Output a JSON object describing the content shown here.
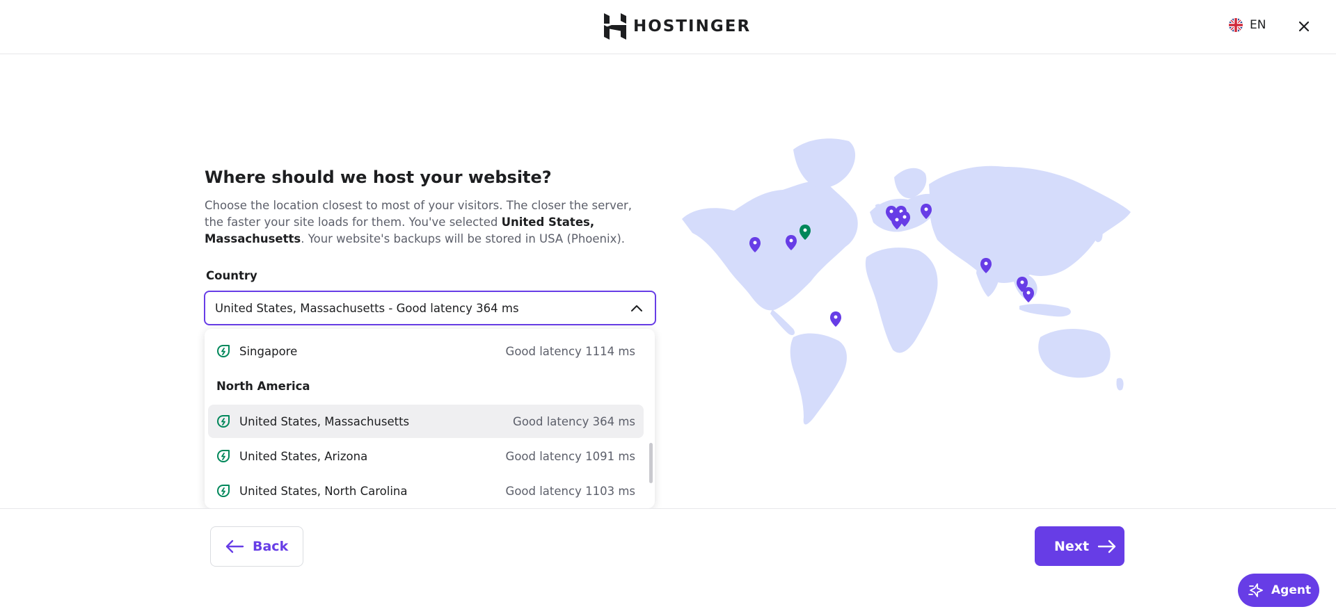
{
  "header": {
    "brand": "HOSTINGER",
    "language": "EN"
  },
  "page": {
    "title": "Where should we host your website?",
    "description_part1": "Choose the location closest to most of your visitors. The closer the server, the faster your site loads for them. You've selected ",
    "selected_location": "United States, Massachusetts",
    "description_part2": ". Your website's backups will be stored in USA (Phoenix)."
  },
  "country_field": {
    "label": "Country",
    "value": "United States, Massachusetts - Good latency 364 ms"
  },
  "dropdown": {
    "items": [
      {
        "name": "Singapore",
        "latency": "Good latency 1114 ms"
      },
      {
        "name": "United States, Massachusetts",
        "latency": "Good latency 364 ms",
        "active": true
      },
      {
        "name": "United States, Arizona",
        "latency": "Good latency 1091 ms"
      },
      {
        "name": "United States, North Carolina",
        "latency": "Good latency 1103 ms"
      }
    ],
    "group_north_america": "North America"
  },
  "map": {
    "pin_color": "#673de6",
    "selected_pin_color": "#00875a",
    "land_color": "#d5dcfb"
  },
  "footer": {
    "back_label": "Back",
    "next_label": "Next",
    "agent_label": "Agent"
  },
  "colors": {
    "accent": "#673de6",
    "text": "#1d1e20",
    "muted": "#5c5f6a",
    "eco_green": "#00875a"
  }
}
